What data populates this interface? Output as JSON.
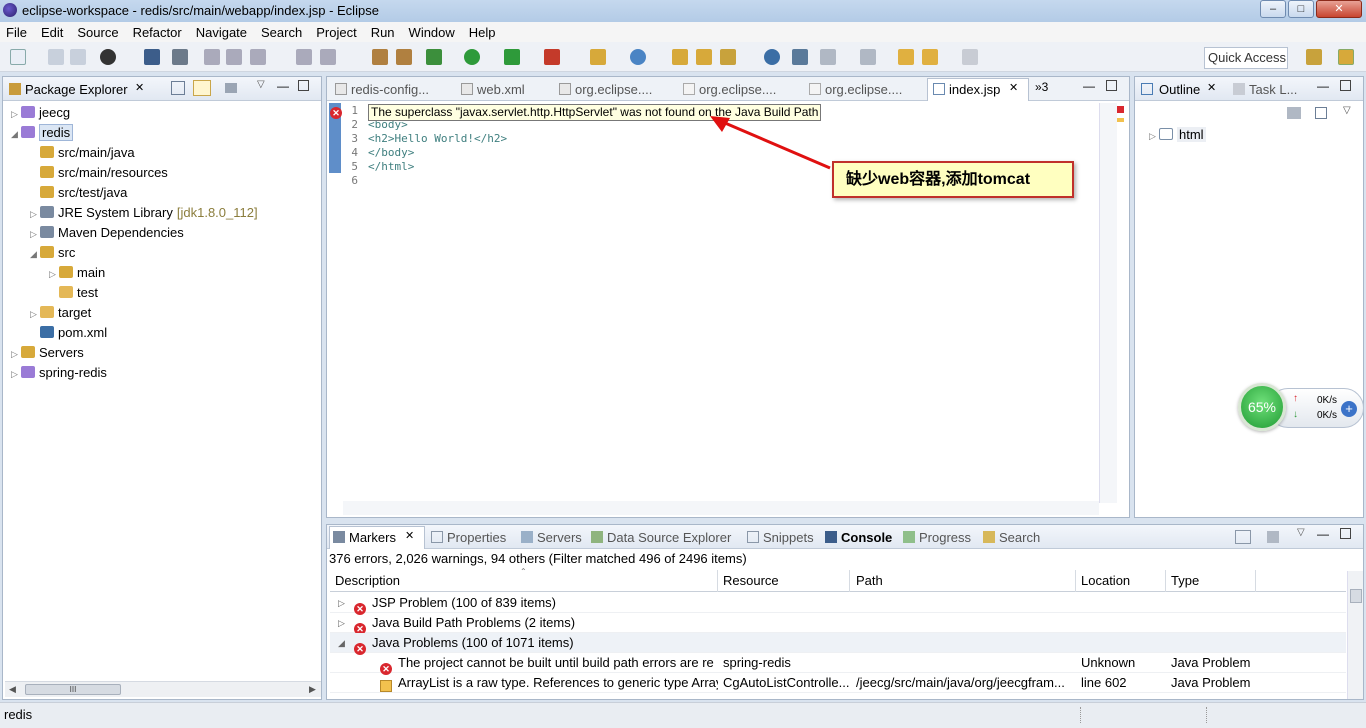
{
  "window": {
    "title": "eclipse-workspace - redis/src/main/webapp/index.jsp - Eclipse",
    "minimize": "–",
    "maximize": "□",
    "close": "✕"
  },
  "menu": [
    "File",
    "Edit",
    "Source",
    "Refactor",
    "Navigate",
    "Search",
    "Project",
    "Run",
    "Window",
    "Help"
  ],
  "toolbar": {
    "quick_access": "Quick Access"
  },
  "package_explorer": {
    "title": "Package Explorer",
    "tree": [
      {
        "label": "jeecg",
        "depth": 0,
        "expand": "▷"
      },
      {
        "label": "redis",
        "depth": 0,
        "expand": "◢"
      },
      {
        "label": "src/main/java",
        "depth": 1,
        "expand": ""
      },
      {
        "label": "src/main/resources",
        "depth": 1,
        "expand": ""
      },
      {
        "label": "src/test/java",
        "depth": 1,
        "expand": ""
      },
      {
        "label": "JRE System Library",
        "suffix": "[jdk1.8.0_112]",
        "depth": 1,
        "expand": "▷"
      },
      {
        "label": "Maven Dependencies",
        "depth": 1,
        "expand": "▷"
      },
      {
        "label": "src",
        "depth": 1,
        "expand": "◢"
      },
      {
        "label": "main",
        "depth": 2,
        "expand": "▷"
      },
      {
        "label": "test",
        "depth": 2,
        "expand": ""
      },
      {
        "label": "target",
        "depth": 1,
        "expand": "▷"
      },
      {
        "label": "pom.xml",
        "depth": 1,
        "expand": ""
      },
      {
        "label": "Servers",
        "depth": 0,
        "expand": "▷"
      },
      {
        "label": "spring-redis",
        "depth": 0,
        "expand": "▷"
      }
    ],
    "scroll_label": "III"
  },
  "editor": {
    "tabs": [
      "redis-config...",
      "web.xml",
      "org.eclipse....",
      "org.eclipse....",
      "org.eclipse....",
      "index.jsp"
    ],
    "overflow": "»3",
    "error_tooltip": "The superclass \"javax.servlet.http.HttpServlet\" was not found on the Java Build Path",
    "lines": [
      {
        "n": "1",
        "text": ""
      },
      {
        "n": "2",
        "text": "<body>"
      },
      {
        "n": "3",
        "text": "<h2>Hello World!</h2>"
      },
      {
        "n": "4",
        "text": "</body>"
      },
      {
        "n": "5",
        "text": "</html>"
      },
      {
        "n": "6",
        "text": ""
      }
    ],
    "callout": "缺少web容器,添加tomcat"
  },
  "outline": {
    "tabs": [
      "Outline",
      "Task L..."
    ],
    "node": "html"
  },
  "net_widget": {
    "percent": "65%",
    "up": "0K/s",
    "down": "0K/s"
  },
  "bottom": {
    "tabs": [
      "Markers",
      "Properties",
      "Servers",
      "Data Source Explorer",
      "Snippets",
      "Console",
      "Progress",
      "Search"
    ],
    "summary": "376 errors, 2,026 warnings, 94 others (Filter matched 496 of 2496 items)",
    "columns": [
      "Description",
      "Resource",
      "Path",
      "Location",
      "Type"
    ],
    "rows": [
      {
        "expand": "▷",
        "kind": "error",
        "indent": 0,
        "desc": "JSP Problem (100 of 839 items)",
        "resource": "",
        "path": "",
        "location": "",
        "type": ""
      },
      {
        "expand": "▷",
        "kind": "error",
        "indent": 0,
        "desc": "Java Build Path Problems (2 items)",
        "resource": "",
        "path": "",
        "location": "",
        "type": ""
      },
      {
        "expand": "◢",
        "kind": "error",
        "indent": 0,
        "desc": "Java Problems (100 of 1071 items)",
        "resource": "",
        "path": "",
        "location": "",
        "type": ""
      },
      {
        "expand": "",
        "kind": "error",
        "indent": 1,
        "desc": "The project cannot be built until build path errors are re",
        "resource": "spring-redis",
        "path": "",
        "location": "Unknown",
        "type": "Java Problem"
      },
      {
        "expand": "",
        "kind": "warning",
        "indent": 1,
        "desc": "ArrayList is a raw type. References to generic type Array",
        "resource": "CgAutoListControlle...",
        "path": "/jeecg/src/main/java/org/jeecgfram...",
        "location": "line 602",
        "type": "Java Problem"
      }
    ]
  },
  "status": {
    "text": "redis"
  },
  "colors": {
    "callout_bg": "#ffffc0",
    "callout_border": "#c0302b",
    "arrow": "#e01010",
    "accent": "#3b6ea5"
  }
}
